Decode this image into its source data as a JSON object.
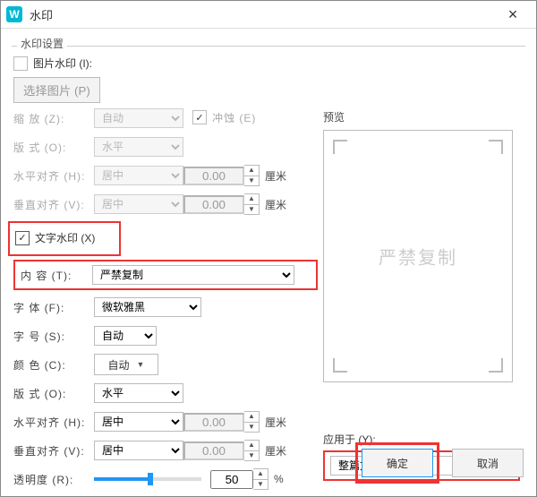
{
  "window": {
    "title": "水印"
  },
  "section_title": "水印设置",
  "image_wm": {
    "checkbox_label": "图片水印 (I):",
    "choose_btn": "选择图片 (P)",
    "scale_label": "缩   放 (Z):",
    "scale_value": "自动",
    "erode_label": "冲蚀 (E)",
    "layout_label": "版   式 (O):",
    "layout_value": "水平",
    "halign_label": "水平对齐 (H):",
    "halign_value": "居中",
    "halign_num": "0.00",
    "valign_label": "垂直对齐 (V):",
    "valign_value": "居中",
    "valign_num": "0.00",
    "unit": "厘米"
  },
  "text_wm": {
    "checkbox_label": "文字水印 (X)",
    "content_label": "内   容 (T):",
    "content_value": "严禁复制",
    "font_label": "字   体 (F):",
    "font_value": "微软雅黑",
    "size_label": "字   号 (S):",
    "size_value": "自动",
    "color_label": "颜   色 (C):",
    "color_value": "自动",
    "layout_label": "版   式 (O):",
    "layout_value": "水平",
    "halign_label": "水平对齐 (H):",
    "halign_value": "居中",
    "halign_num": "0.00",
    "valign_label": "垂直对齐 (V):",
    "valign_value": "居中",
    "valign_num": "0.00",
    "opacity_label": "透明度 (R):",
    "opacity_value": "50",
    "opacity_unit": "%",
    "unit": "厘米"
  },
  "preview": {
    "label": "预览",
    "watermark_text": "严禁复制"
  },
  "apply": {
    "label": "应用于 (Y):",
    "value": "整篇文档"
  },
  "actions": {
    "ok": "确定",
    "cancel": "取消"
  }
}
